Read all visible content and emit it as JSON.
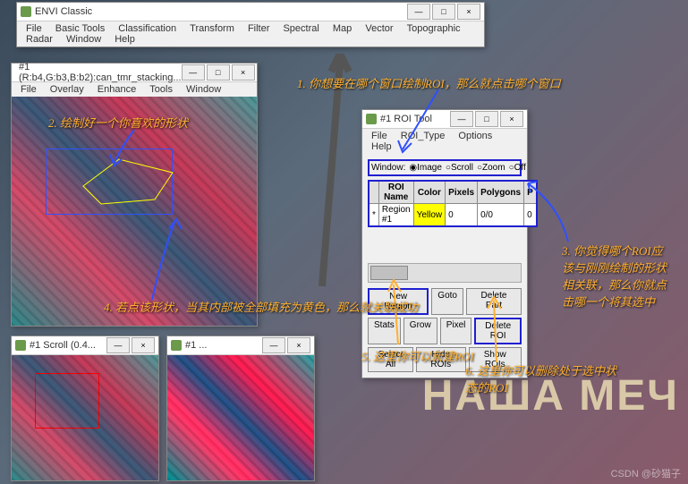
{
  "bg_text": "НАША МЕЧ",
  "watermark": "CSDN @砂猫子",
  "envi": {
    "title": "ENVI Classic",
    "menus": [
      "File",
      "Basic Tools",
      "Classification",
      "Transform",
      "Filter",
      "Spectral",
      "Map",
      "Vector",
      "Topographic",
      "Radar",
      "Window",
      "Help"
    ],
    "min": "—",
    "max": "□",
    "close": "×"
  },
  "img_win": {
    "title": "#1 (R:b4,G:b3,B:b2):can_tmr_stacking...",
    "menus": [
      "File",
      "Overlay",
      "Enhance",
      "Tools",
      "Window"
    ],
    "min": "—",
    "max": "□",
    "close": "×"
  },
  "scroll_win": {
    "title": "#1 Scroll (0.4...",
    "min": "—",
    "close": "×"
  },
  "zoom_win": {
    "title": "#1 ...",
    "min": "—",
    "close": "×"
  },
  "roi": {
    "title": "#1 ROI Tool",
    "menus": [
      "File",
      "ROI_Type",
      "Options",
      "Help"
    ],
    "min": "—",
    "max": "□",
    "close": "×",
    "window_label": "Window:",
    "radios": [
      {
        "l": "Image",
        "c": true
      },
      {
        "l": "Scroll",
        "c": false
      },
      {
        "l": "Zoom",
        "c": false
      },
      {
        "l": "Off",
        "c": false
      }
    ],
    "headers": [
      "",
      "ROI Name",
      "Color",
      "Pixels",
      "Polygons",
      "P"
    ],
    "row": {
      "mark": "*",
      "name": "Region #1",
      "color": "Yellow",
      "pixels": "0",
      "polygons": "0/0",
      "p": "0"
    },
    "btns": {
      "new_region": "New Region",
      "goto": "Goto",
      "delete_part": "Delete Part",
      "stats": "Stats",
      "grow": "Grow",
      "pixel": "Pixel",
      "delete_roi": "Delete ROI",
      "select_all": "Select All",
      "hide_rois": "Hide ROIs",
      "show_rois": "Show ROIs"
    }
  },
  "annos": {
    "a1": "1. 你想要在哪个窗口绘制ROI，那么就点击哪个窗口",
    "a2": "2. 绘制好一个你喜欢的形状",
    "a3": "3. 你觉得哪个ROI应该与刚刚绘制的形状相关联，那么你就点击哪一个将其选中",
    "a4": "4. 若点该形状，当其内部被全部填充为黄色，那么就关联成功",
    "a5": "5. 这里你可以新建ROI",
    "a6": "6. 这里你可以删除处于选中状态的ROI"
  }
}
